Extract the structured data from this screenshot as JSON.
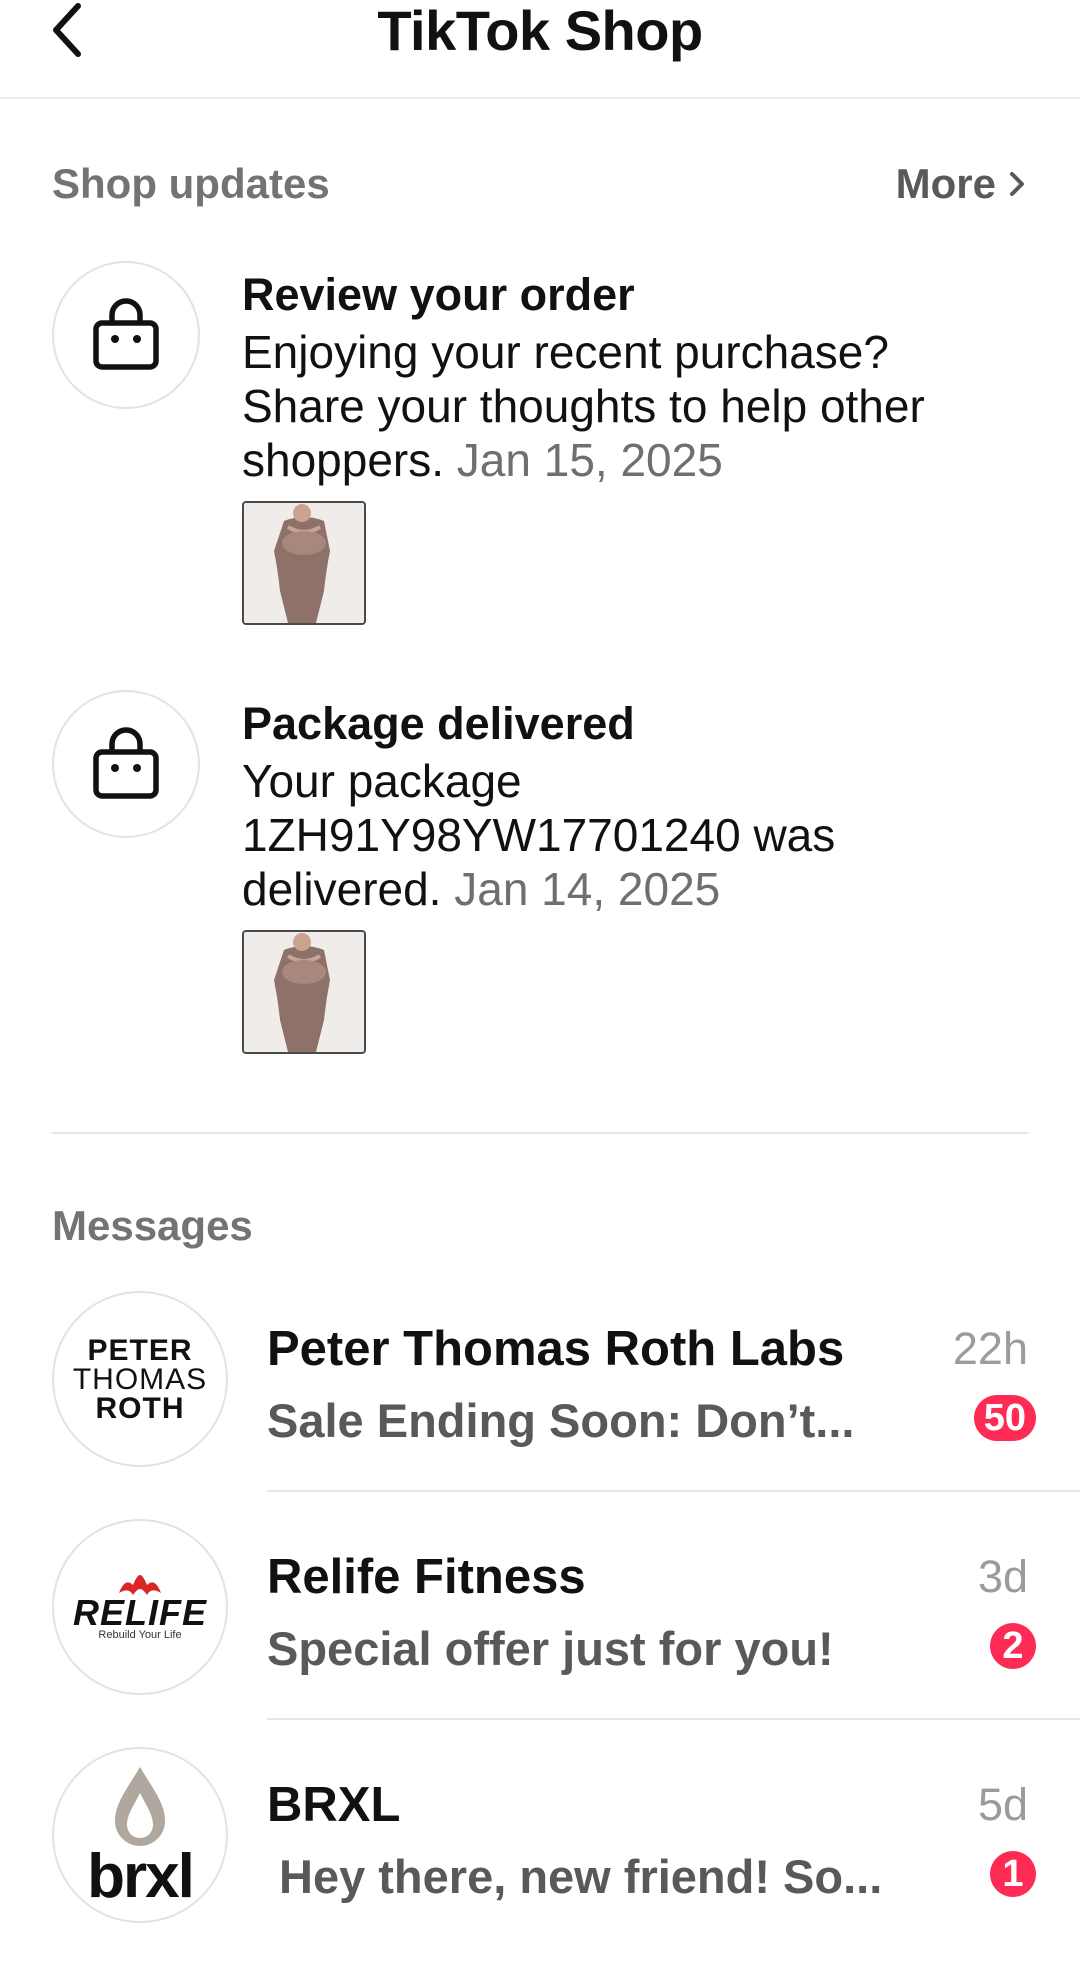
{
  "header": {
    "title": "TikTok Shop",
    "back_icon": "chevron-left-icon"
  },
  "shop_updates": {
    "section_title": "Shop updates",
    "more_label": "More",
    "items": [
      {
        "icon": "shopping-bag-icon",
        "title": "Review your order",
        "body": "Enjoying your recent purchase? Share your thoughts to help other shoppers.",
        "date": "Jan 15, 2025",
        "thumbnail": "product-image"
      },
      {
        "icon": "shopping-bag-icon",
        "title": "Package delivered",
        "body": "Your package 1ZH91Y98YW17701240 was delivered.",
        "date": "Jan 14, 2025",
        "thumbnail": "product-image"
      }
    ]
  },
  "messages": {
    "section_title": "Messages",
    "items": [
      {
        "name": "Peter Thomas Roth Labs",
        "preview": "Sale Ending Soon: Don’t...",
        "time": "22h",
        "unread": "50",
        "logo_lines": [
          "PETER",
          "THOMAS",
          "ROTH"
        ]
      },
      {
        "name": "Relife Fitness",
        "preview": "Special offer just for you!",
        "time": "3d",
        "unread": "2",
        "logo_text": "RELIFE",
        "logo_tagline": "Rebuild Your Life"
      },
      {
        "name": "BRXL",
        "preview": "Hey there, new friend! So...",
        "time": "5d",
        "unread": "1",
        "logo_text": "brxl"
      }
    ]
  },
  "colors": {
    "accent": "#fe2c55",
    "muted_text": "#737373",
    "divider": "#e6e6e6"
  }
}
